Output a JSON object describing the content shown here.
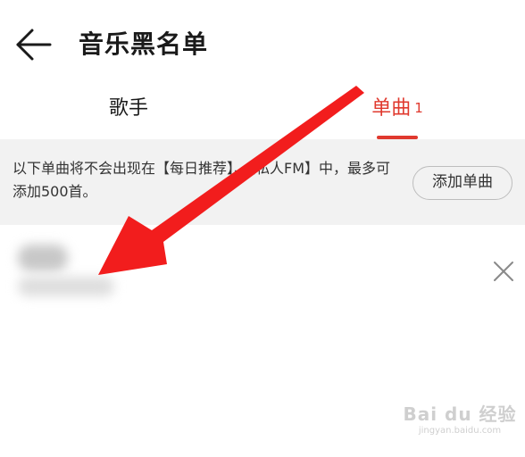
{
  "header": {
    "title": "音乐黑名单",
    "back_icon": "arrow-left-icon"
  },
  "tabs": [
    {
      "label": "歌手",
      "selected": false
    },
    {
      "label": "单曲",
      "count": "1",
      "selected": true
    }
  ],
  "banner": {
    "text": "以下单曲将不会出现在【每日推荐】、【私人FM】中，最多可添加500首。",
    "add_button_label": "添加单曲"
  },
  "song_list": {
    "items": [
      {
        "remove_icon": "close-icon"
      }
    ]
  },
  "colors": {
    "accent": "#e0392e",
    "banner_bg": "#f2f2f2",
    "annotation_arrow": "#f21d1d"
  },
  "watermark": {
    "logo": "Bai du 经验",
    "url": "jingyan.baidu.com"
  }
}
